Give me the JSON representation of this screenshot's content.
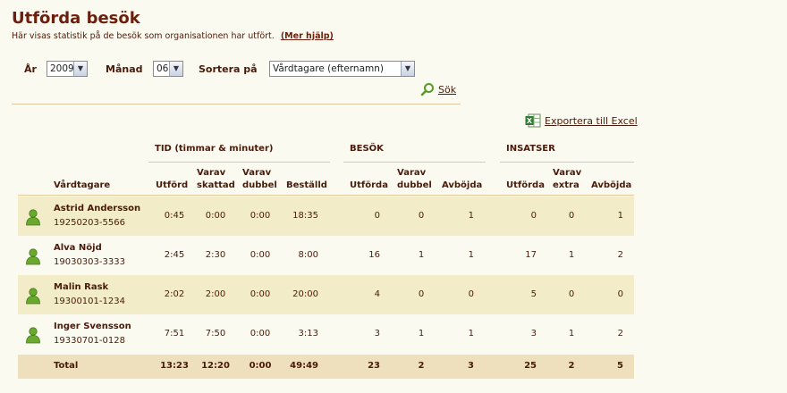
{
  "page": {
    "title": "Utförda besök",
    "subtitle": "Här visas statistik på de besök som organisationen har utfört.",
    "help_link": "(Mer hjälp)"
  },
  "filters": {
    "year_label": "År",
    "year_value": "2009",
    "month_label": "Månad",
    "month_value": "06",
    "sort_label": "Sortera på",
    "sort_value": "Vårdtagare (efternamn)",
    "search_label": "Sök"
  },
  "export_label": "Exportera till Excel",
  "groups": {
    "tid": "TID (timmar & minuter)",
    "besok": "BESÖK",
    "insatser": "INSATSER"
  },
  "columns": {
    "vardtagare": "Vårdtagare",
    "tid_utford": "Utförd",
    "tid_skattad": [
      "Varav",
      "skattad"
    ],
    "tid_dubbel": [
      "Varav",
      "dubbel"
    ],
    "tid_bestalld": "Beställd",
    "besok_utforda": "Utförda",
    "besok_dubbel": [
      "Varav",
      "dubbel"
    ],
    "besok_avbojda": "Avböjda",
    "ins_utforda": "Utförda",
    "ins_extra": [
      "Varav",
      "extra"
    ],
    "ins_avbojda": "Avböjda"
  },
  "rows": [
    {
      "name": "Astrid Andersson",
      "ssn": "19250203-5566",
      "tid_utford": "0:45",
      "tid_skattad": "0:00",
      "tid_dubbel": "0:00",
      "tid_bestalld": "18:35",
      "besok_utforda": "0",
      "besok_dubbel": "0",
      "besok_avbojda": "1",
      "ins_utforda": "0",
      "ins_extra": "0",
      "ins_avbojda": "1"
    },
    {
      "name": "Alva Nöjd",
      "ssn": "19030303-3333",
      "tid_utford": "2:45",
      "tid_skattad": "2:30",
      "tid_dubbel": "0:00",
      "tid_bestalld": "8:00",
      "besok_utforda": "16",
      "besok_dubbel": "1",
      "besok_avbojda": "1",
      "ins_utforda": "17",
      "ins_extra": "1",
      "ins_avbojda": "2"
    },
    {
      "name": "Malin Rask",
      "ssn": "19300101-1234",
      "tid_utford": "2:02",
      "tid_skattad": "2:00",
      "tid_dubbel": "0:00",
      "tid_bestalld": "20:00",
      "besok_utforda": "4",
      "besok_dubbel": "0",
      "besok_avbojda": "0",
      "ins_utforda": "5",
      "ins_extra": "0",
      "ins_avbojda": "0"
    },
    {
      "name": "Inger Svensson",
      "ssn": "19330701-0128",
      "tid_utford": "7:51",
      "tid_skattad": "7:50",
      "tid_dubbel": "0:00",
      "tid_bestalld": "3:13",
      "besok_utforda": "3",
      "besok_dubbel": "1",
      "besok_avbojda": "1",
      "ins_utforda": "3",
      "ins_extra": "1",
      "ins_avbojda": "2"
    }
  ],
  "total": {
    "label": "Total",
    "tid_utford": "13:23",
    "tid_skattad": "12:20",
    "tid_dubbel": "0:00",
    "tid_bestalld": "49:49",
    "besok_utforda": "23",
    "besok_dubbel": "2",
    "besok_avbojda": "3",
    "ins_utforda": "25",
    "ins_extra": "2",
    "ins_avbojda": "5"
  },
  "colors": {
    "title": "#6b1f0c",
    "row_alt": "#f3ecc8",
    "row_total": "#eee0bc",
    "avatar": "#6aa92e"
  }
}
